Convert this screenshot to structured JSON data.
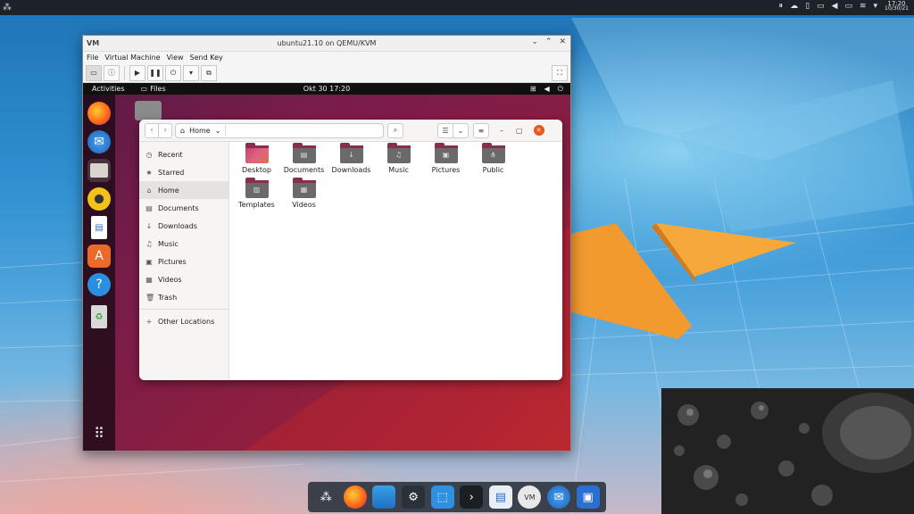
{
  "top_panel": {
    "clock_time": "17:20",
    "clock_date": "10/30/21"
  },
  "vm_window": {
    "title": "ubuntu21.10 on QEMU/KVM",
    "app_icon": "VM",
    "menu": [
      "File",
      "Virtual Machine",
      "View",
      "Send Key"
    ]
  },
  "guest": {
    "activities": "Activities",
    "app_menu": "Files",
    "clock": "Okt 30  17:20"
  },
  "files": {
    "path_label": "Home",
    "sidebar": [
      {
        "label": "Recent",
        "icon": "clock-icon",
        "glyph": "◷"
      },
      {
        "label": "Starred",
        "icon": "star-icon",
        "glyph": "★"
      },
      {
        "label": "Home",
        "icon": "home-icon",
        "glyph": "⌂"
      },
      {
        "label": "Documents",
        "icon": "document-icon",
        "glyph": "▤"
      },
      {
        "label": "Downloads",
        "icon": "download-icon",
        "glyph": "↓"
      },
      {
        "label": "Music",
        "icon": "music-icon",
        "glyph": "♫"
      },
      {
        "label": "Pictures",
        "icon": "picture-icon",
        "glyph": "▣"
      },
      {
        "label": "Videos",
        "icon": "video-icon",
        "glyph": "▦"
      },
      {
        "label": "Trash",
        "icon": "trash-icon",
        "glyph": "🗑"
      }
    ],
    "other_locations": "Other Locations",
    "folders": [
      {
        "label": "Desktop",
        "glyph": ""
      },
      {
        "label": "Documents",
        "glyph": "▤"
      },
      {
        "label": "Downloads",
        "glyph": "↓"
      },
      {
        "label": "Music",
        "glyph": "♫"
      },
      {
        "label": "Pictures",
        "glyph": "▣"
      },
      {
        "label": "Public",
        "glyph": "⋔"
      },
      {
        "label": "Templates",
        "glyph": "▥"
      },
      {
        "label": "Videos",
        "glyph": "▦"
      }
    ]
  }
}
